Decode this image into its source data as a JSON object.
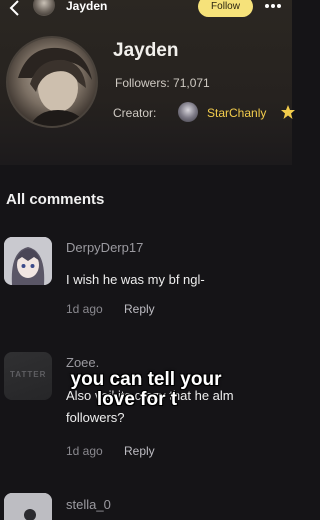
{
  "header": {
    "back_icon": "chevron-left-icon",
    "name": "Jayden",
    "follow_label": "Follow",
    "follow_color": "#f6e27a",
    "more_icon": "more-horizontal-icon"
  },
  "profile": {
    "name": "Jayden",
    "followers": "Followers: 71,071",
    "creator_label": "Creator:",
    "creator_name": "StarChanly",
    "creator_badge_icon": "star-icon",
    "creator_color": "#f2cc4c"
  },
  "comments_section": {
    "title": "All comments",
    "items": [
      {
        "user": "DerpyDerp17",
        "text": "I wish he was my bf ngl-",
        "time": "1d ago",
        "reply_label": "Reply"
      },
      {
        "user": "Zoee.",
        "text": "Also vail its crazy that he alm",
        "text_line2": "followers?",
        "avatar_text": "TATTER",
        "time": "1d ago",
        "reply_label": "Reply"
      },
      {
        "user": "stella_0"
      }
    ]
  },
  "overlay_caption": {
    "line1": "you can tell your",
    "line2": "love for t"
  }
}
